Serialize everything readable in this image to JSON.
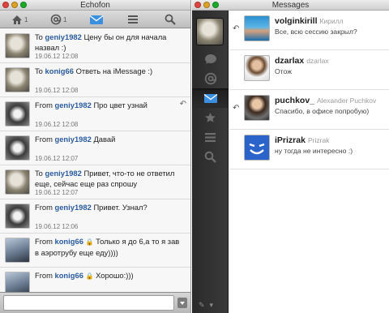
{
  "left_window": {
    "title": "Echofon",
    "toolbar": {
      "home_count": "1",
      "mentions_count": "1"
    },
    "messages": [
      {
        "direction": "To",
        "user": "geniy1982",
        "text": "Цену бы он для начала",
        "text2": "назвал :)",
        "time": "19.06.12 12:08",
        "avatar": "av-cat",
        "reply": false,
        "lock": false
      },
      {
        "direction": "To",
        "user": "konig66",
        "text": "Ответь на iMessage :)",
        "text2": "",
        "time": "19.06.12 12:08",
        "avatar": "av-cat",
        "reply": false,
        "lock": false
      },
      {
        "direction": "From",
        "user": "geniy1982",
        "text": "Про цвет узнай",
        "text2": "",
        "time": "19.06.12 12:08",
        "avatar": "av-phone",
        "reply": true,
        "lock": false
      },
      {
        "direction": "From",
        "user": "geniy1982",
        "text": "Давай",
        "text2": "",
        "time": "19.06.12 12:07",
        "avatar": "av-phone",
        "reply": false,
        "lock": false
      },
      {
        "direction": "To",
        "user": "geniy1982",
        "text": "Привет, что-то не ответил",
        "text2": "еще, сейчас еще раз спрошу",
        "time": "19.06.12 12:07",
        "avatar": "av-cat",
        "reply": false,
        "lock": false
      },
      {
        "direction": "From",
        "user": "geniy1982",
        "text": "Привет. Узнал?",
        "text2": "",
        "time": "19.06.12 12:06",
        "avatar": "av-phone",
        "reply": false,
        "lock": false
      },
      {
        "direction": "From",
        "user": "konig66",
        "text": "Только я до 6,а то я завтра",
        "text2": "в аэротрубу еще еду))))",
        "time": "",
        "avatar": "av-yoga",
        "reply": false,
        "lock": true
      },
      {
        "direction": "From",
        "user": "konig66",
        "text": "Хорошо:)))",
        "text2": "",
        "time": "",
        "avatar": "av-yoga",
        "reply": false,
        "lock": true
      }
    ],
    "composer": {
      "value": ""
    }
  },
  "right_window": {
    "title": "Messages",
    "conversations": [
      {
        "name": "volginkirill",
        "realname": "Кирилл",
        "preview": "Все, всю сессию закрыл?",
        "avatar": "cv-water",
        "replied": true
      },
      {
        "name": "dzarlax",
        "realname": "dzarlax",
        "preview": "Отож",
        "avatar": "cv-man",
        "replied": false
      },
      {
        "name": "puchkov_",
        "realname": "Alexander Puchkov",
        "preview": "Спасибо, в офисе попробую)",
        "avatar": "cv-man2",
        "replied": true
      },
      {
        "name": "iPrizrak",
        "realname": "Prizrak",
        "preview": "ну тогда не интересно :)",
        "avatar": "cv-smile",
        "replied": false
      }
    ]
  },
  "colors": {
    "link_blue": "#2b5c9e",
    "sidebar_dark": "#2f2f2f",
    "active_blue": "#3b8fe0"
  },
  "icons": {
    "reply": "↶"
  }
}
